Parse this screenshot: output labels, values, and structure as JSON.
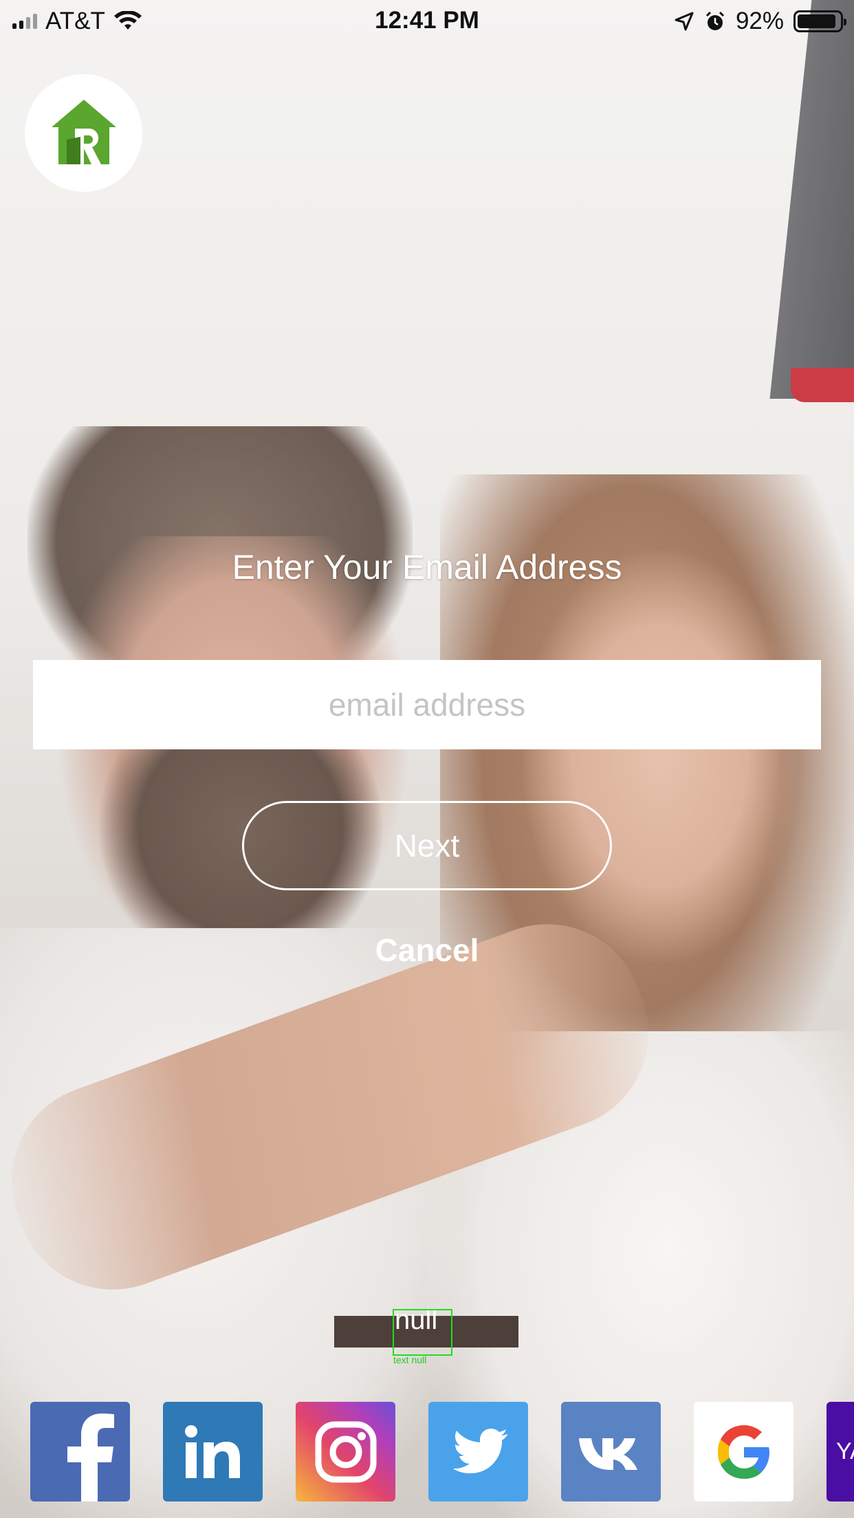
{
  "status_bar": {
    "carrier": "AT&T",
    "time": "12:41 PM",
    "battery_percent": "92%",
    "battery_level": 0.92
  },
  "form": {
    "title": "Enter Your Email Address",
    "email_placeholder": "email address",
    "next_label": "Next",
    "cancel_label": "Cancel"
  },
  "debug": {
    "null_label": "null",
    "null_caption": "text null"
  },
  "social": {
    "items": [
      {
        "name": "facebook",
        "icon": "facebook-icon",
        "color": "#4a6ab4"
      },
      {
        "name": "linkedin",
        "icon": "linkedin-icon",
        "color": "#2f79b7"
      },
      {
        "name": "instagram",
        "icon": "instagram-icon",
        "color": "#b23fb8"
      },
      {
        "name": "twitter",
        "icon": "twitter-icon",
        "color": "#4aa3ea"
      },
      {
        "name": "vk",
        "icon": "vk-icon",
        "color": "#5a83c3"
      },
      {
        "name": "google",
        "icon": "google-icon",
        "color": "#ffffff"
      },
      {
        "name": "yahoo",
        "icon": "yahoo-icon",
        "color": "#4a0ea4",
        "text": "YA"
      }
    ]
  },
  "colors": {
    "logo_green": "#5aa62e",
    "accent_white": "#ffffff"
  }
}
